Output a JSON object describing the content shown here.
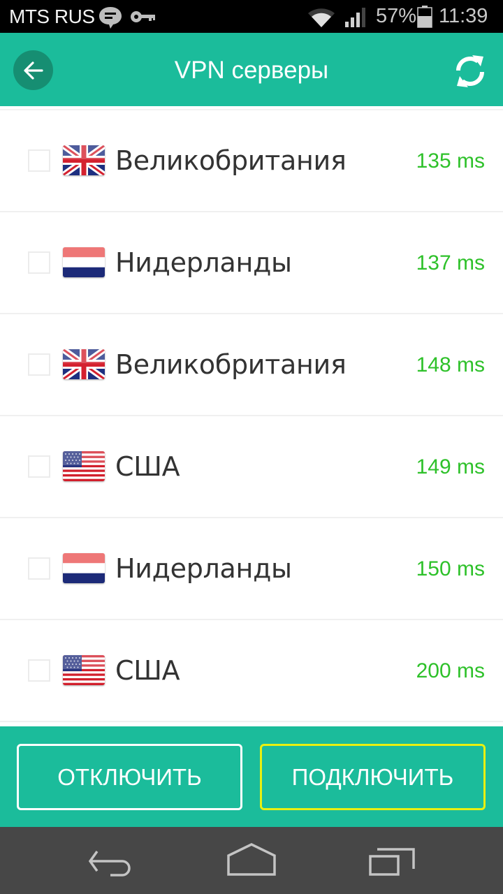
{
  "status_bar": {
    "carrier": "MTS RUS",
    "battery": "57%",
    "time": "11:39",
    "icons": [
      "message-icon",
      "vpn-key-icon",
      "wifi-icon",
      "signal-icon",
      "battery-icon"
    ]
  },
  "app_bar": {
    "title": "VPN серверы",
    "back_icon": "arrow-left-icon",
    "refresh_icon": "refresh-icon"
  },
  "servers": [
    {
      "country": "Великобритания",
      "flag": "uk",
      "latency": "135 ms",
      "checked": false
    },
    {
      "country": "Нидерланды",
      "flag": "nl",
      "latency": "137 ms",
      "checked": false
    },
    {
      "country": "Великобритания",
      "flag": "uk",
      "latency": "148 ms",
      "checked": false
    },
    {
      "country": "США",
      "flag": "us",
      "latency": "149 ms",
      "checked": false
    },
    {
      "country": "Нидерланды",
      "flag": "nl",
      "latency": "150 ms",
      "checked": false
    },
    {
      "country": "США",
      "flag": "us",
      "latency": "200 ms",
      "checked": false
    }
  ],
  "buttons": {
    "disconnect": "ОТКЛЮЧИТЬ",
    "connect": "ПОДКЛЮЧИТЬ"
  },
  "colors": {
    "accent": "#1bbc9b",
    "back_button": "#168e72",
    "latency": "#2ec12a",
    "connect_border": "#e8f010",
    "nav_bar": "#474747"
  },
  "nav_bar": {
    "icons": [
      "back-nav-icon",
      "home-nav-icon",
      "recents-nav-icon"
    ]
  }
}
